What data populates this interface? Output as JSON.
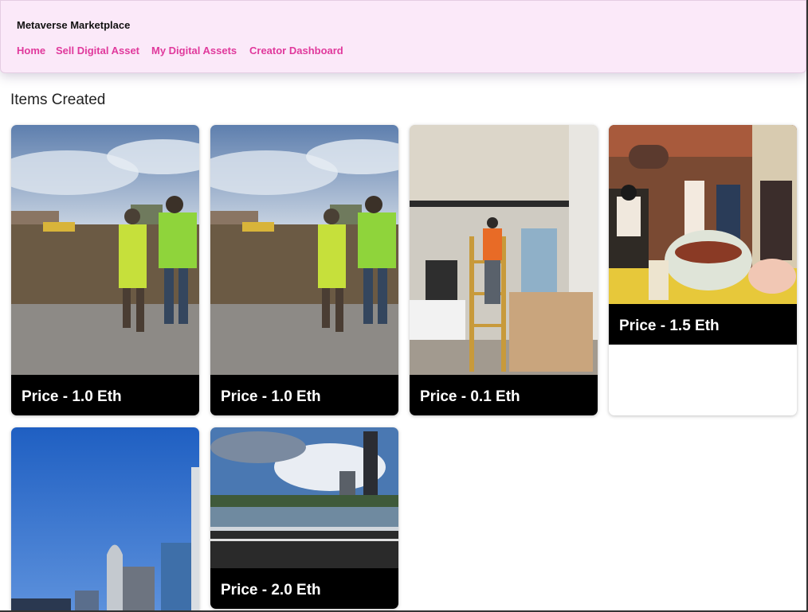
{
  "navbar": {
    "brand": "Metaverse Marketplace",
    "links": [
      "Home",
      "Sell Digital Asset",
      "My Digital Assets",
      "Creator Dashboard"
    ]
  },
  "section_title": "Items Created",
  "items": [
    {
      "image": "construction-site-workers-photo",
      "price_label": "Price - 1.0 Eth"
    },
    {
      "image": "construction-site-workers-photo",
      "price_label": "Price - 1.0 Eth"
    },
    {
      "image": "interior-worker-on-ladder-photo",
      "price_label": "Price - 0.1 Eth"
    },
    {
      "image": "retro-diner-train-illustration",
      "price_label": "Price - 1.5 Eth"
    },
    {
      "image": "city-skyscrapers-blue-sky-photo",
      "price_label": ""
    },
    {
      "image": "lake-city-skyline-boat-photo",
      "price_label": "Price - 2.0 Eth"
    }
  ],
  "colors": {
    "nav_background": "#fbe9f9",
    "nav_link": "#e0399c",
    "price_bar": "#000000"
  }
}
